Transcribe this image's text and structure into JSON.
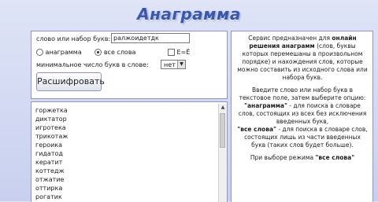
{
  "page": {
    "title": "Анаграмма"
  },
  "form": {
    "word_label": "слово или набор букв:",
    "word_value": "ралжоидетдк",
    "mode_anagram": "анаграмма",
    "mode_all": "все слова",
    "ee_label": "Е=Ё",
    "minlen_label": "минимальное число букв в слове:",
    "minlen_value": "нет",
    "decode_button": "Расшифровать"
  },
  "results": [
    "горжетка",
    "диктатор",
    "игротека",
    "трикотаж",
    "героика",
    "гидатод",
    "кератит",
    "коттедж",
    "отжатие",
    "оттирка",
    "рогатик"
  ],
  "info": {
    "p1_a": "Сервис предназначен для",
    "p1_b": "онлайн решения анаграмм",
    "p1_c": "(слов, буквы которых перемешаны в произвольном порядке) и нахождения слов, которые можно составить из исходного слова или набора букв.",
    "p2_a": "Введите слово или набор букв в текстовое поле, затем выберите опцию:",
    "p2_b": "\"анаграмма\"",
    "p2_c": "- для поиска в словаре слов, состоящих из всех без исключения введенных букв,",
    "p2_d": "\"все слова\"",
    "p2_e": "- для поиска в словаре слов, состоящих лишь из части введенных букв (таких слов будет больше).",
    "p3_a": "При выборе режима",
    "p3_b": "\"все слова\""
  }
}
